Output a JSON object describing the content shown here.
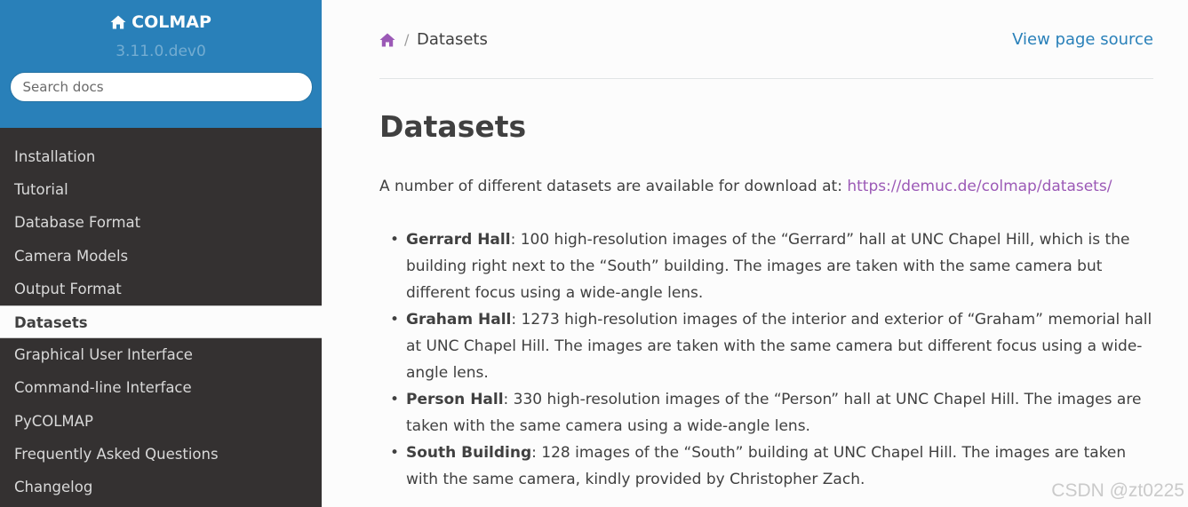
{
  "sidebar": {
    "brand": "COLMAP",
    "version": "3.11.0.dev0",
    "search_placeholder": "Search docs",
    "items": [
      {
        "label": "Installation"
      },
      {
        "label": "Tutorial"
      },
      {
        "label": "Database Format"
      },
      {
        "label": "Camera Models"
      },
      {
        "label": "Output Format"
      },
      {
        "label": "Datasets",
        "current": true
      },
      {
        "label": "Graphical User Interface"
      },
      {
        "label": "Command-line Interface"
      },
      {
        "label": "PyCOLMAP"
      },
      {
        "label": "Frequently Asked Questions"
      },
      {
        "label": "Changelog"
      }
    ]
  },
  "breadcrumb": {
    "separator": "/",
    "current": "Datasets",
    "view_source": "View page source"
  },
  "main": {
    "title": "Datasets",
    "intro_text": "A number of different datasets are available for download at: ",
    "intro_link": "https://demuc.de/colmap/datasets/",
    "datasets": [
      {
        "name": "Gerrard Hall",
        "description": ": 100 high-resolution images of the “Gerrard” hall at UNC Chapel Hill, which is the building right next to the “South” building. The images are taken with the same camera but different focus using a wide-angle lens."
      },
      {
        "name": "Graham Hall",
        "description": ": 1273 high-resolution images of the interior and exterior of “Graham” memorial hall at UNC Chapel Hill. The images are taken with the same camera but different focus using a wide-angle lens."
      },
      {
        "name": "Person Hall",
        "description": ": 330 high-resolution images of the “Person” hall at UNC Chapel Hill. The images are taken with the same camera using a wide-angle lens."
      },
      {
        "name": "South Building",
        "description": ": 128 images of the “South” building at UNC Chapel Hill. The images are taken with the same camera, kindly provided by Christopher Zach."
      }
    ]
  },
  "watermark": "CSDN @zt0225",
  "colors": {
    "sidebar_header": "#2980b9",
    "sidebar_bg": "#343131",
    "link": "#2980b9",
    "visited_link": "#9b59b6",
    "text": "#404040"
  },
  "icons": {
    "brand": "home-icon",
    "breadcrumb_home": "home-icon"
  }
}
